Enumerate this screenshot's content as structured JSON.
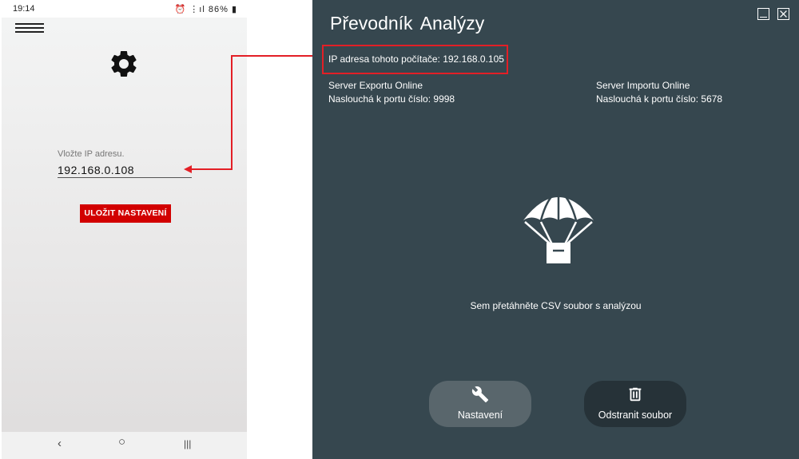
{
  "phone": {
    "status": {
      "time": "19:14",
      "battery": "86%"
    },
    "ip_label": "Vložte IP adresu.",
    "ip_value": "192.168.0.108",
    "save_button": "ULOŽIT NASTAVENÍ",
    "nav": {
      "back": "‹",
      "home": "○",
      "recents": "|||"
    }
  },
  "window": {
    "title": "Převodník  Analýzy",
    "ip_line": "IP adresa tohoto počítače: 192.168.0.105",
    "export_server": {
      "status": "Server Exportu Online",
      "port": "Naslouchá k portu číslo: 9998"
    },
    "import_server": {
      "status": "Server Importu  Online",
      "port": "Naslouchá k portu číslo: 5678"
    },
    "drop_hint": "Sem přetáhněte CSV soubor s analýzou",
    "settings_button": "Nastavení",
    "delete_button": "Odstranit soubor"
  },
  "icons": [
    "menu-icon",
    "gear-icon",
    "parachute-icon",
    "wrench-icon",
    "trash-icon",
    "minimize-icon",
    "close-icon"
  ],
  "colors": {
    "window_bg": "#36474f",
    "save_button": "#d20000",
    "highlight_box": "#e31f26"
  }
}
